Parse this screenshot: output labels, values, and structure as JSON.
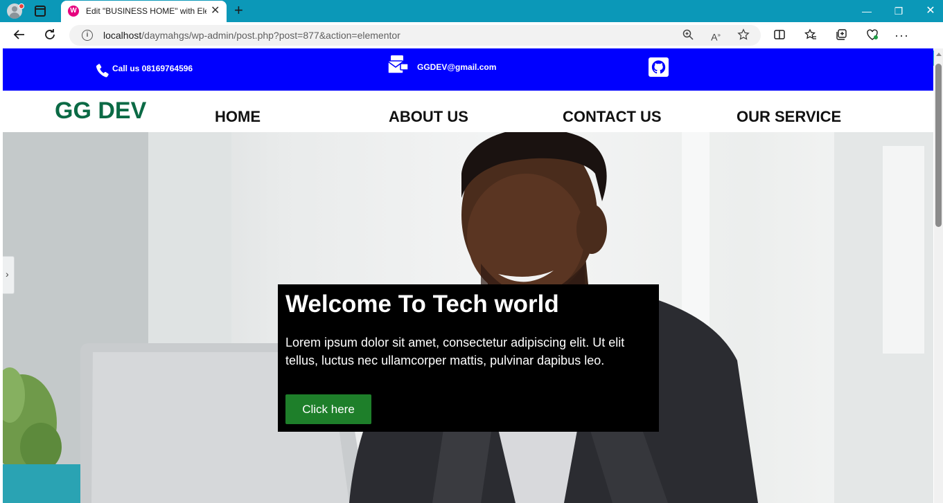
{
  "browser": {
    "tab_title": "Edit \"BUSINESS HOME\" with Elementor",
    "tab_favicon_letter": "W",
    "tab_close_glyph": "✕",
    "new_tab_glyph": "+",
    "url_host": "localhost",
    "url_path": "/daymahgs/wp-admin/post.php?post=877&action=elementor",
    "window_controls": {
      "minimize": "—",
      "maximize": "❐",
      "close": "✕"
    }
  },
  "page": {
    "topbar": {
      "background": "#0000ff",
      "phone_label": "Call us 08169764596",
      "email_label": "GGDEV@gmail.com",
      "icons": [
        "phone-icon",
        "mail-icon",
        "github-icon"
      ]
    },
    "header": {
      "logo": "GG DEV",
      "logo_color": "#0b6a45",
      "menu": [
        {
          "label": "HOME"
        },
        {
          "label": "ABOUT US"
        },
        {
          "label": "CONTACT US"
        },
        {
          "label": "OUR SERVICE"
        }
      ]
    },
    "hero": {
      "title": "Welcome To Tech world",
      "text": "Lorem ipsum dolor sit amet, consectetur adipiscing elit. Ut elit tellus, luctus nec ullamcorper mattis, pulvinar dapibus leo.",
      "button_label": "Click here",
      "button_color": "#1e7f2a",
      "panel_color": "#000000"
    }
  }
}
